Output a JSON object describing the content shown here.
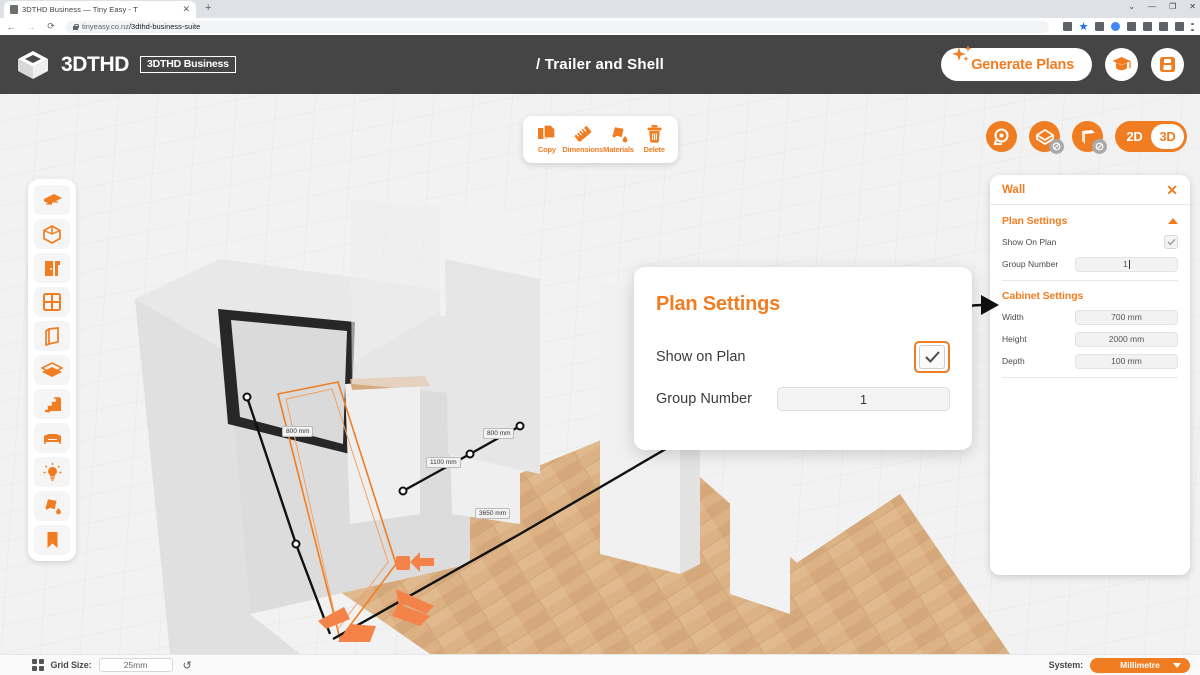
{
  "browser": {
    "tab_title": "3DTHD Business — Tiny Easy - T",
    "tab_close": "✕",
    "new_tab": "+",
    "back": "←",
    "forward": "→",
    "reload": "⟳",
    "url_host": "tinyeasy.co.nz",
    "url_path": "/3dthd-business-suite",
    "window_controls": [
      "⌄",
      "—",
      "❐",
      "✕"
    ]
  },
  "header": {
    "brand_name": "3DTHD",
    "brand_badge": "3DTHD Business",
    "title": "/ Trailer and Shell",
    "generate_plans_label": "Generate Plans",
    "tutorial_icon": "graduation-cap-icon",
    "save_icon": "save-lock-icon"
  },
  "toolbar": {
    "items": [
      {
        "label": "Copy",
        "icon": "copy-icon"
      },
      {
        "label": "Dimensions",
        "icon": "ruler-icon"
      },
      {
        "label": "Materials",
        "icon": "paint-bucket-icon"
      },
      {
        "label": "Delete",
        "icon": "trash-icon"
      }
    ]
  },
  "view_controls": {
    "buttons": [
      {
        "icon": "tape-measure-icon",
        "badge": false
      },
      {
        "icon": "roof-visibility-icon",
        "badge": true
      },
      {
        "icon": "wall-visibility-icon",
        "badge": true
      }
    ],
    "dimension_toggle": {
      "options": [
        "2D",
        "3D"
      ],
      "active": "3D"
    }
  },
  "sidebar": {
    "items": [
      {
        "name": "trailer",
        "icon": "trailer-icon"
      },
      {
        "name": "shell",
        "icon": "cube-shell-icon"
      },
      {
        "name": "door",
        "icon": "door-icon"
      },
      {
        "name": "window",
        "icon": "window-icon"
      },
      {
        "name": "wall",
        "icon": "wall-panel-icon"
      },
      {
        "name": "floor",
        "icon": "floor-layers-icon"
      },
      {
        "name": "stairs",
        "icon": "stairs-icon"
      },
      {
        "name": "furniture",
        "icon": "sofa-icon"
      },
      {
        "name": "lighting",
        "icon": "light-bulb-icon"
      },
      {
        "name": "materials",
        "icon": "paint-bucket-icon"
      },
      {
        "name": "bookmarks",
        "icon": "bookmark-icon"
      }
    ]
  },
  "properties_panel": {
    "title": "Wall",
    "close_label": "✕",
    "plan_settings": {
      "title": "Plan Settings",
      "show_on_plan_label": "Show On Plan",
      "show_on_plan_checked": true,
      "group_number_label": "Group Number",
      "group_number_value": "1"
    },
    "cabinet_settings": {
      "title": "Cabinet Settings",
      "rows": [
        {
          "label": "Width",
          "value": "700 mm"
        },
        {
          "label": "Height",
          "value": "2000 mm"
        },
        {
          "label": "Depth",
          "value": "100 mm"
        }
      ]
    }
  },
  "modal": {
    "title": "Plan Settings",
    "show_on_plan_label": "Show on Plan",
    "show_on_plan_checked": true,
    "group_number_label": "Group Number",
    "group_number_value": "1"
  },
  "bottom_bar": {
    "grid_size_label": "Grid Size:",
    "grid_size_value": "25mm",
    "reset_icon": "reset-arrow-icon",
    "system_label": "System:",
    "system_value": "Millimetre"
  },
  "scene": {
    "dimension_labels": [
      "800 mm",
      "1100 mm",
      "800 mm",
      "3650 mm"
    ]
  },
  "colors": {
    "accent": "#f07d22",
    "header_bg": "#454545",
    "panel_bg": "#ffffff",
    "viewport_bg": "#f4f4f4",
    "wood": "#d8ab7e"
  }
}
